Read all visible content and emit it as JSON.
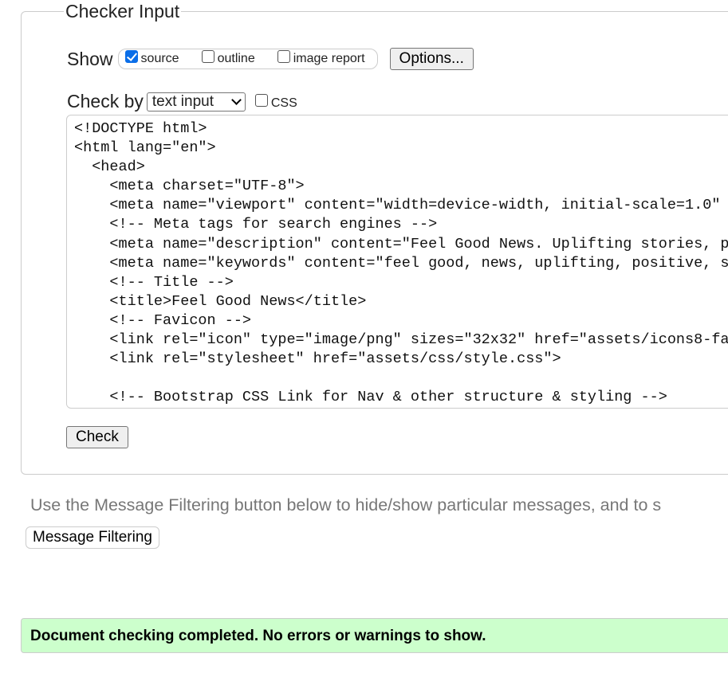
{
  "fieldset": {
    "legend": "Checker Input",
    "show_label": "Show",
    "show_options": [
      {
        "label": "source",
        "checked": true
      },
      {
        "label": "outline",
        "checked": false
      },
      {
        "label": "image report",
        "checked": false
      }
    ],
    "options_button": "Options...",
    "check_by_label": "Check by",
    "check_by_value": "text input",
    "css_label": "CSS",
    "css_checked": false,
    "source_text": "<!DOCTYPE html>\n<html lang=\"en\">\n  <head>\n    <meta charset=\"UTF-8\">\n    <meta name=\"viewport\" content=\"width=device-width, initial-scale=1.0\"\n    <!-- Meta tags for search engines -->\n    <meta name=\"description\" content=\"Feel Good News. Uplifting stories, p\n    <meta name=\"keywords\" content=\"feel good, news, uplifting, positive, s\n    <!-- Title -->\n    <title>Feel Good News</title>\n    <!-- Favicon -->\n    <link rel=\"icon\" type=\"image/png\" sizes=\"32x32\" href=\"assets/icons8-fa\n    <link rel=\"stylesheet\" href=\"assets/css/style.css\">\n\n    <!-- Bootstrap CSS Link for Nav & other structure & styling -->",
    "check_button": "Check"
  },
  "filter_note": "Use the Message Filtering button below to hide/show particular messages, and to s",
  "message_filtering_button": "Message Filtering",
  "success_message": "Document checking completed. No errors or warnings to show.",
  "colors": {
    "success_bg": "#ccffcc",
    "accent": "#0b6ee8"
  }
}
